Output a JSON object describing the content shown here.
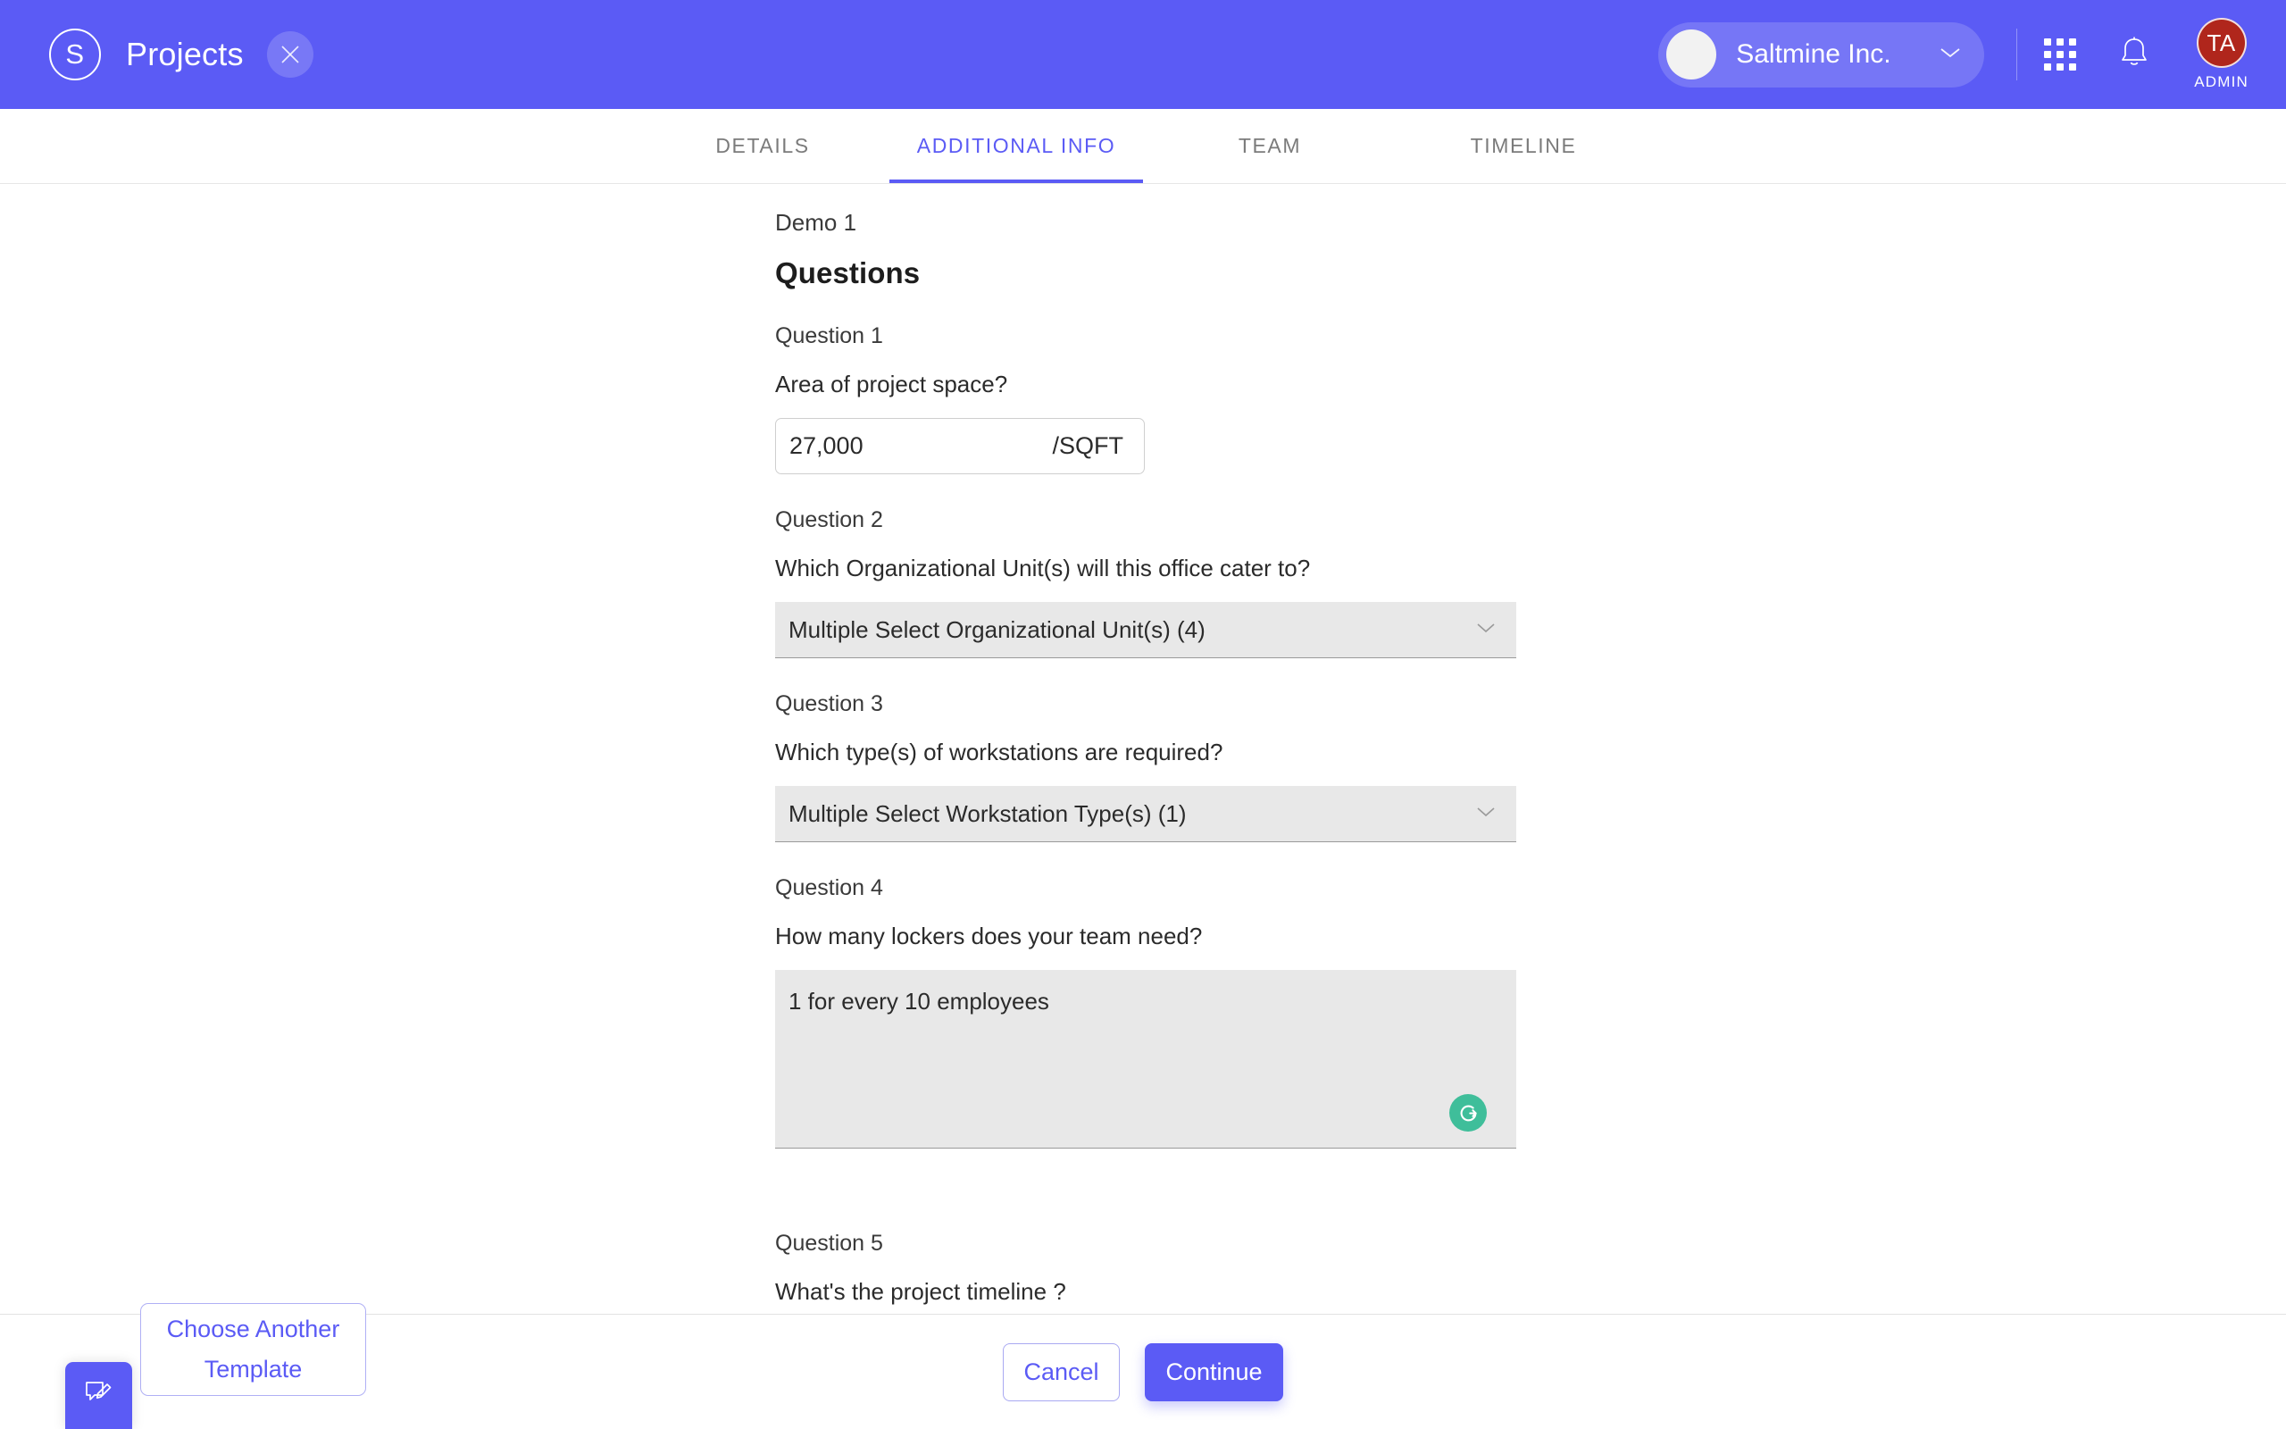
{
  "header": {
    "logo_letter": "S",
    "title": "Projects",
    "close_icon": "close-icon",
    "org": {
      "name": "Saltmine Inc.",
      "caret_icon": "chevron-down-icon"
    },
    "apps_icon": "apps-grid-icon",
    "notifications_icon": "bell-icon",
    "user": {
      "initials": "TA",
      "role": "ADMIN"
    }
  },
  "tabs": [
    {
      "label": "DETAILS",
      "active": false
    },
    {
      "label": "ADDITIONAL INFO",
      "active": true
    },
    {
      "label": "TEAM",
      "active": false
    },
    {
      "label": "TIMELINE",
      "active": false
    }
  ],
  "form": {
    "project_name": "Demo 1",
    "section_title": "Questions",
    "questions": [
      {
        "label": "Question 1",
        "text": "Area of project space?",
        "type": "number_unit",
        "value": "27,000",
        "unit": "/SQFT"
      },
      {
        "label": "Question 2",
        "text": "Which Organizational Unit(s) will this office cater to?",
        "type": "select",
        "value": "Multiple Select Organizational Unit(s) (4)"
      },
      {
        "label": "Question 3",
        "text": "Which type(s) of workstations are required?",
        "type": "select",
        "value": "Multiple Select Workstation Type(s) (1)"
      },
      {
        "label": "Question 4",
        "text": "How many lockers does your team need?",
        "type": "textarea",
        "value": "1 for every 10 employees",
        "assistant_icon": "grammarly-icon"
      },
      {
        "label": "Question 5",
        "text": "What's the project timeline ?",
        "type": "text",
        "value": ""
      }
    ]
  },
  "footer": {
    "choose_template_line1": "Choose Another",
    "choose_template_line2": "Template",
    "cancel_label": "Cancel",
    "continue_label": "Continue",
    "feedback_icon": "feedback-edit-icon"
  },
  "colors": {
    "brand_purple": "#5B5BF5",
    "avatar_red": "#B0261C",
    "assistant_green": "#3FBE9A",
    "field_grey": "#E8E8E8"
  }
}
